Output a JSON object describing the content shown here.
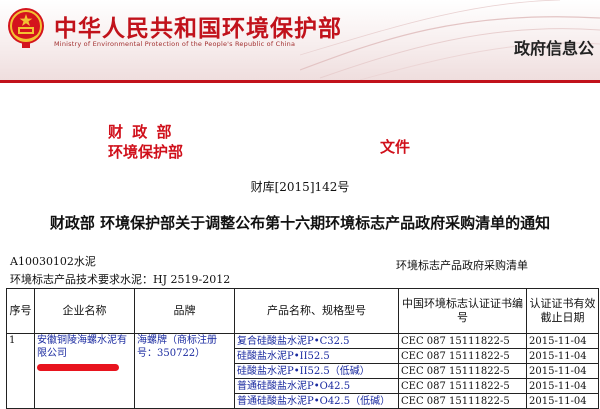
{
  "header": {
    "ministry_cn": "中华人民共和国环境保护部",
    "ministry_en": "Ministry of Environmental Protection of the People's Republic of China",
    "section_title": "政府信息公",
    "accent_color": "#c1121b"
  },
  "document": {
    "issuer_line1": "财 政 部",
    "issuer_line2": "环境保护部",
    "file_word": "文件",
    "doc_number": "财库[2015]142号",
    "title": "财政部  环境保护部关于调整公布第十六期环境标志产品政府采购清单的通知",
    "category_code": "A10030102水泥",
    "right_note": "环境标志产品政府采购清单",
    "standard": "环境标志产品技术要求水泥：HJ 2519-2012"
  },
  "table": {
    "headers": [
      "序号",
      "企业名称",
      "品牌",
      "产品名称、规格型号",
      "中国环境标志认证证书编号",
      "认证证书有效截止日期"
    ],
    "group": {
      "index": "1",
      "company": "安徽铜陵海螺水泥有限公司",
      "brand": "海螺牌（商标注册号：350722）"
    },
    "rows": [
      {
        "product": "复合硅酸盐水泥P•C32.5",
        "cert": "CEC 087 15111822-5",
        "date": "2015-11-04"
      },
      {
        "product": "硅酸盐水泥P•II52.5",
        "cert": "CEC 087 15111822-5",
        "date": "2015-11-04"
      },
      {
        "product": "硅酸盐水泥P•II52.5（低碱）",
        "cert": "CEC 087 15111822-5",
        "date": "2015-11-04"
      },
      {
        "product": "普通硅酸盐水泥P•O42.5",
        "cert": "CEC 087 15111822-5",
        "date": "2015-11-04"
      },
      {
        "product": "普通硅酸盐水泥P•O42.5（低碱）",
        "cert": "CEC 087 15111822-5",
        "date": "2015-11-04"
      }
    ]
  }
}
